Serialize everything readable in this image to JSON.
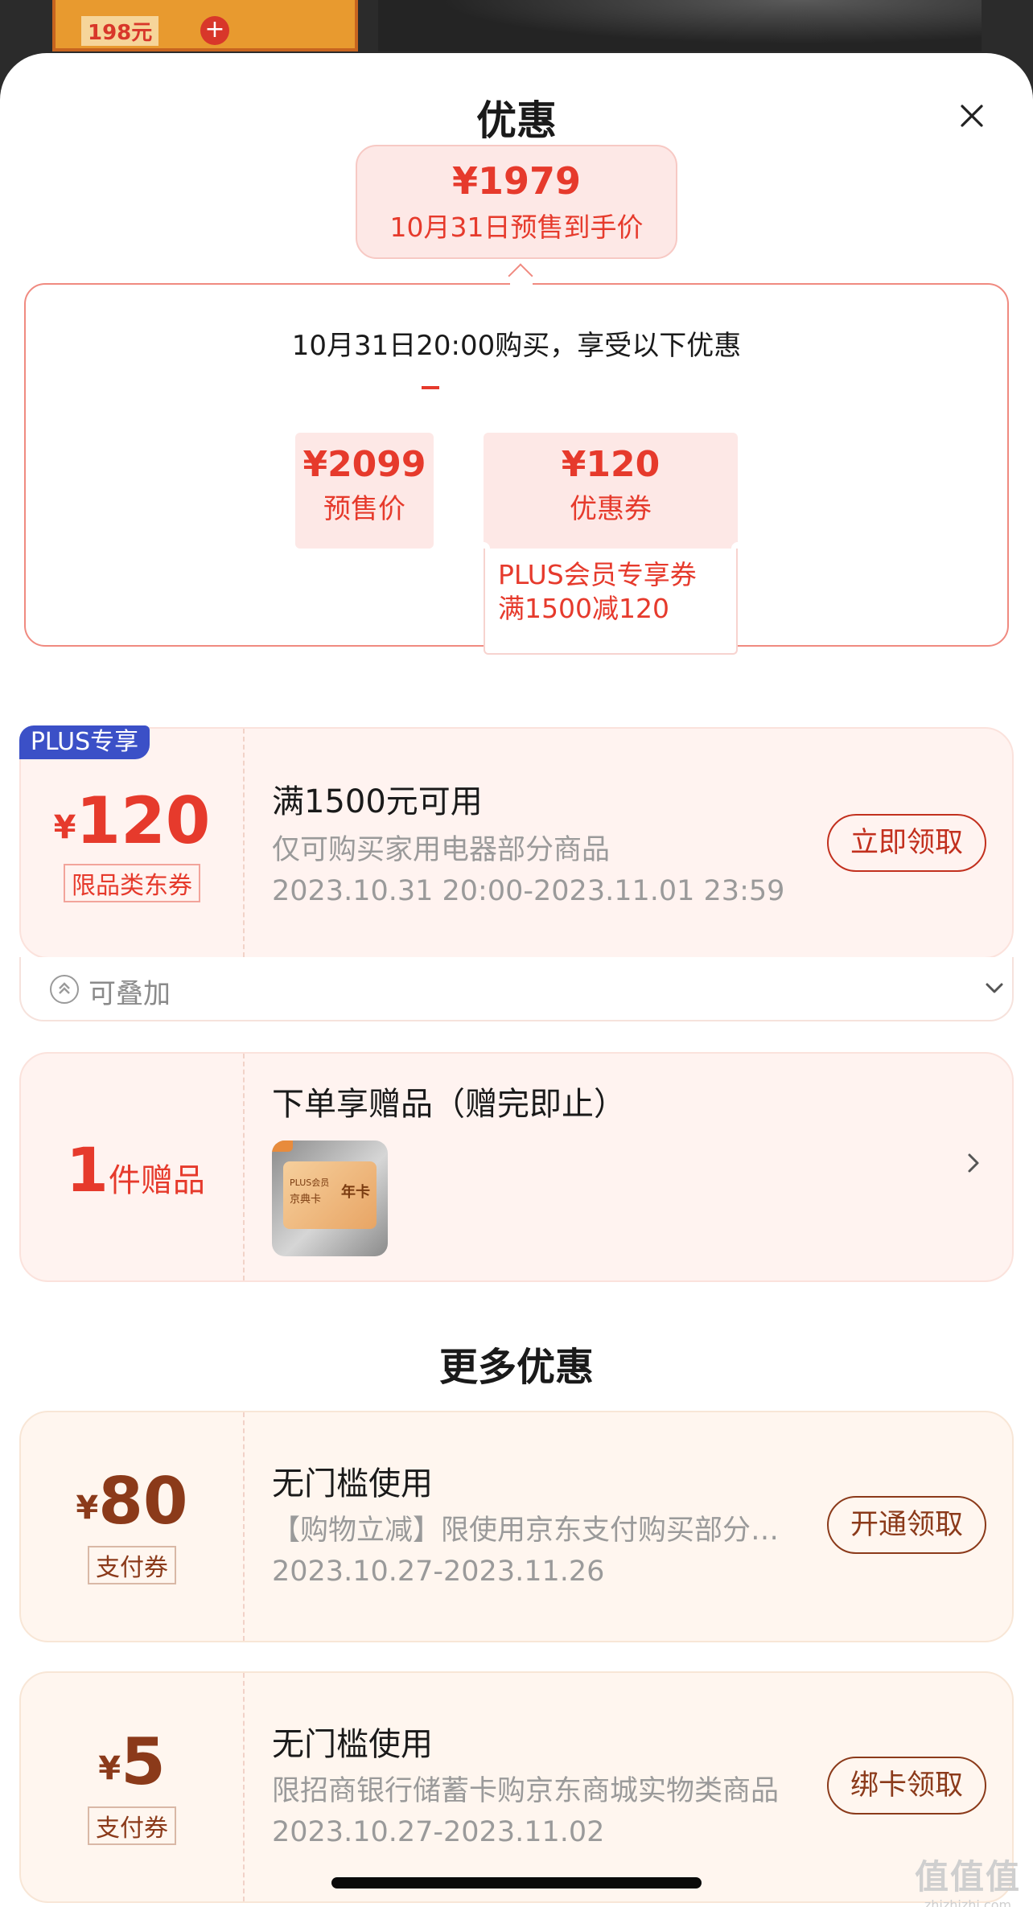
{
  "backdrop": {
    "price_text": "198元",
    "plus_glyph": "+"
  },
  "sheet": {
    "title": "优惠",
    "close_icon": "close-icon"
  },
  "final_price": {
    "price": "¥1979",
    "label": "10月31日预售到手价"
  },
  "breakdown": {
    "subtitle": "10月31日20:00购买，享受以下优惠",
    "presale": {
      "value": "¥2099",
      "label": "预售价"
    },
    "coupon": {
      "value": "¥120",
      "label": "优惠券"
    },
    "coupon_note_line1": "PLUS会员专享券",
    "coupon_note_line2": "满1500减120"
  },
  "plus_coupon": {
    "badge": "PLUS专享",
    "currency": "¥",
    "amount": "120",
    "tag": "限品类东券",
    "title": "满1500元可用",
    "desc": "仅可购买家用电器部分商品",
    "date": "2023.10.31 20:00-2023.11.01 23:59",
    "button": "立即领取",
    "stack_label": "可叠加",
    "stack_icon": "stack-icon",
    "expand_icon": "chevron-down-icon"
  },
  "gift": {
    "count": "1",
    "count_label": "件赠品",
    "title": "下单享赠品（赠完即止）",
    "card_line1": "PLUS会员",
    "card_line2": "京典卡",
    "card_year": "年卡",
    "arrow_icon": "chevron-right-icon"
  },
  "more": {
    "section_title": "更多优惠",
    "coupons": [
      {
        "currency": "¥",
        "amount": "80",
        "tag": "支付券",
        "title": "无门槛使用",
        "desc": "【购物立减】限使用京东支付购买部分商品",
        "date": "2023.10.27-2023.11.26",
        "button": "开通领取"
      },
      {
        "currency": "¥",
        "amount": "5",
        "tag": "支付券",
        "title": "无门槛使用",
        "desc": "限招商银行储蓄卡购京东商城实物类商品",
        "date": "2023.10.27-2023.11.02",
        "button": "绑卡领取"
      }
    ]
  },
  "watermark": {
    "main": "值值值",
    "sub": "zhizhizhi.com"
  },
  "colors": {
    "accent_red": "#e63a2c",
    "coupon_dark_red": "#c2301e",
    "plus_blue": "#3b50c7",
    "bubble_pink": "#fde8e6"
  }
}
